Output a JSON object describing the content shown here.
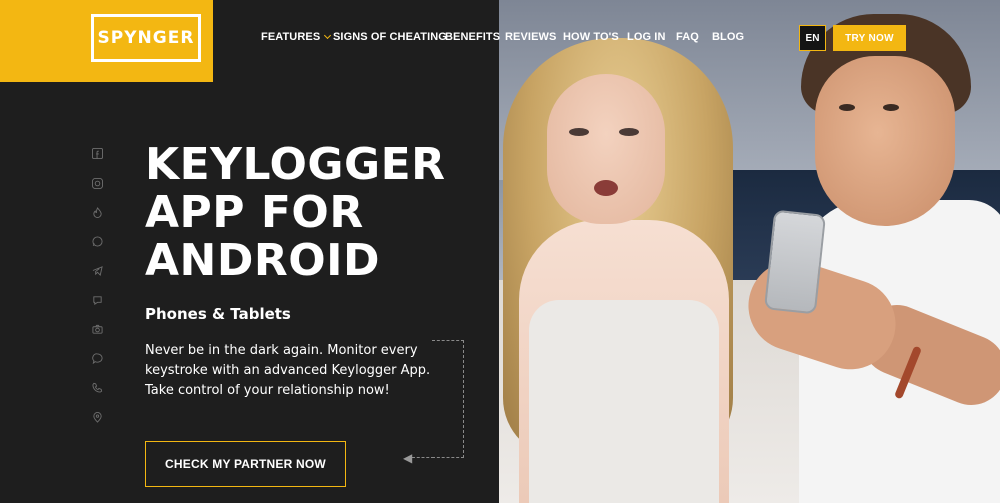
{
  "brand": {
    "logo_text": "SPYNGER",
    "accent_color": "#f3b712"
  },
  "nav": {
    "items": [
      "FEATURES",
      "SIGNS OF CHEATING",
      "BENEFITS",
      "REVIEWS",
      "HOW TO'S",
      "LOG IN",
      "FAQ",
      "BLOG"
    ],
    "language": "EN",
    "cta": "TRY NOW"
  },
  "social_icons": [
    "facebook-icon",
    "instagram-icon",
    "tinder-icon",
    "whatsapp-icon",
    "telegram-icon",
    "viber-icon",
    "camera-icon",
    "messenger-icon",
    "phone-icon",
    "location-icon"
  ],
  "hero": {
    "title": "KEYLOGGER APP FOR ANDROID",
    "subtitle": "Phones & Tablets",
    "description": "Never be in the dark again. Monitor every keystroke with an advanced Keylogger App. Take control of your relationship now!",
    "cta": "CHECK MY PARTNER NOW"
  }
}
